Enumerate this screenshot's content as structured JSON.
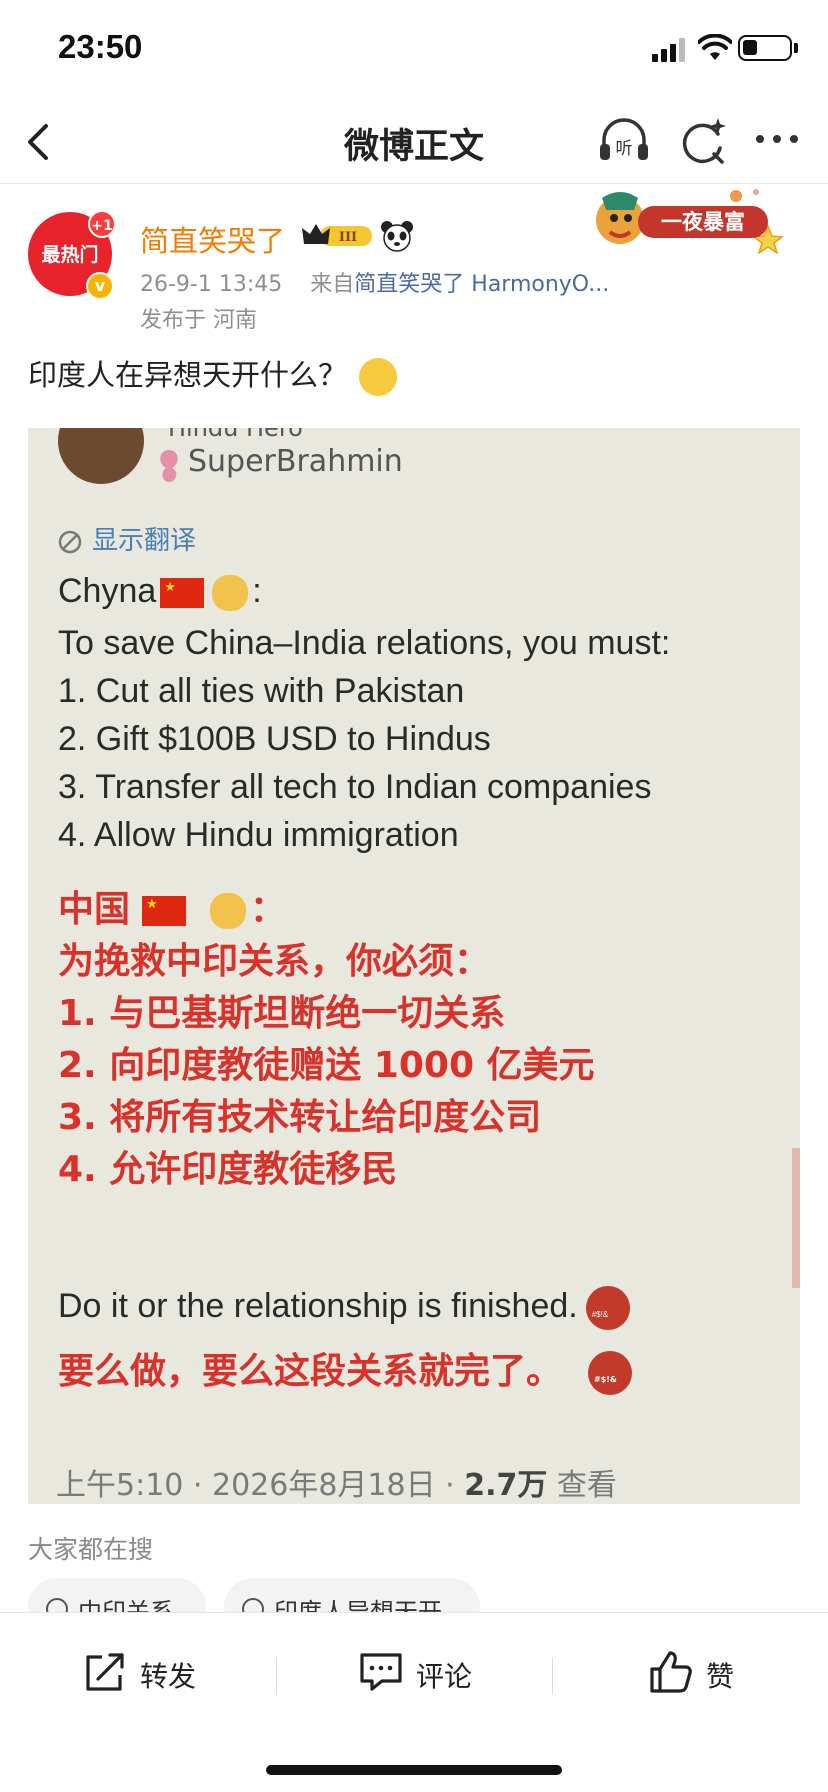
{
  "status_bar": {
    "time": "23:50"
  },
  "nav": {
    "title": "微博正文"
  },
  "post": {
    "avatar_text": "最热门",
    "avatar_badge": "+1",
    "username": "简直笑哭了",
    "meta_time": "26-9-1 13:45",
    "meta_from": "来自",
    "meta_source": "简直笑哭了 HarmonyO...",
    "location": "发布于 河南",
    "promo_label": "一夜暴富",
    "text": "印度人在异想天开什么？"
  },
  "image": {
    "handle_top": "Hindu Hero",
    "handle": "SuperBrahmin",
    "translate_label": "显示翻译",
    "en_greeting": "Chyna",
    "en_lines": [
      "To save China–India relations,  you must:",
      "1. Cut all ties with Pakistan",
      "2. Gift $100B USD to Hindus",
      "3. Transfer all tech to Indian companies",
      "4. Allow Hindu immigration"
    ],
    "cn_greeting": "中国",
    "cn_lines": [
      "为挽救中印关系，你必须：",
      "1. 与巴基斯坦断绝一切关系",
      "2. 向印度教徒赠送 1000 亿美元",
      "3. 将所有技术转让给印度公司",
      "4. 允许印度教徒移民"
    ],
    "en_closing": "Do it or the relationship is finished.",
    "cn_closing": "要么做，要么这段关系就完了。",
    "footer_time": "上午5:10 · 2026年8月18日 · ",
    "footer_views": "2.7万",
    "footer_suffix": " 查看"
  },
  "trending": {
    "title": "大家都在搜",
    "chips": [
      "中印关系",
      "印度人异想天开"
    ]
  },
  "actions": {
    "repost": "转发",
    "comment": "评论",
    "like": "赞"
  },
  "icons": [
    "back-icon",
    "headphones-icon",
    "refresh-sparkle-icon",
    "more-icon",
    "repost-icon",
    "comment-icon",
    "like-icon"
  ],
  "colors": {
    "accent_orange": "#f57c00",
    "link_blue": "#4a6aa5",
    "alert_red": "#d8322b"
  }
}
